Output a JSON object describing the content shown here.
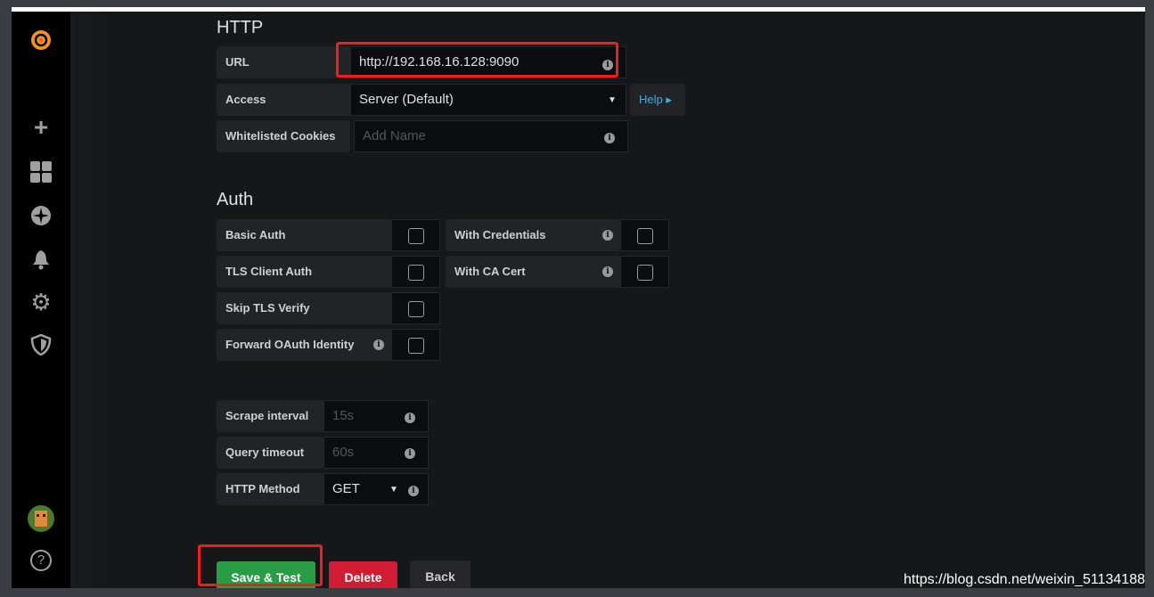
{
  "http": {
    "title": "HTTP",
    "url_label": "URL",
    "url_value": "http://192.168.16.128:9090",
    "access_label": "Access",
    "access_value": "Server (Default)",
    "help": "Help ▸",
    "cookies_label": "Whitelisted Cookies",
    "cookies_placeholder": "Add Name"
  },
  "auth": {
    "title": "Auth",
    "basic": "Basic Auth",
    "tls": "TLS Client Auth",
    "skip": "Skip TLS Verify",
    "oauth": "Forward OAuth Identity",
    "cred": "With Credentials",
    "ca": "With CA Cert"
  },
  "prom": {
    "scrape_label": "Scrape interval",
    "scrape_placeholder": "15s",
    "timeout_label": "Query timeout",
    "timeout_placeholder": "60s",
    "method_label": "HTTP Method",
    "method_value": "GET"
  },
  "buttons": {
    "save": "Save & Test",
    "delete": "Delete",
    "back": "Back"
  },
  "watermark": "https://blog.csdn.net/weixin_51134188",
  "colors": {
    "save": "#299c46",
    "delete": "#d11d34",
    "highlight": "#f21c1c",
    "help": "#33b5e5"
  }
}
